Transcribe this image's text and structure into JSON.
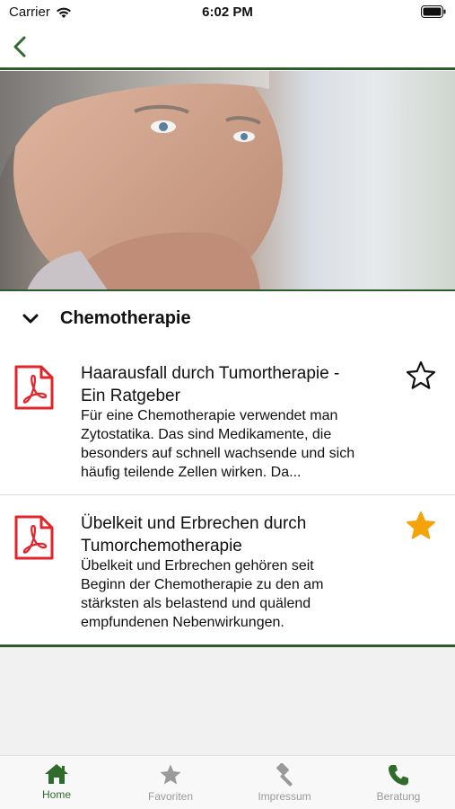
{
  "status_bar": {
    "carrier": "Carrier",
    "time": "6:02 PM"
  },
  "section": {
    "title": "Chemotherapie"
  },
  "documents": [
    {
      "title_line1": "Haarausfall durch Tumortherapie -",
      "title_line2": "Ein Ratgeber",
      "desc_lines": [
        "Für eine Chemotherapie verwendet man",
        "Zytostatika. Das sind Medikamente, die",
        "besonders auf schnell wachsende und sich",
        "häufig teilende Zellen wirken. Da..."
      ],
      "favorite": false
    },
    {
      "title_line1": "Übelkeit und Erbrechen durch",
      "title_line2": "Tumorchemotherapie",
      "desc_lines": [
        "Übelkeit und Erbrechen gehören seit",
        "Beginn der Chemotherapie zu den am",
        "stärksten als belastend und quälend",
        "empfundenen Nebenwirkungen."
      ],
      "favorite": true
    }
  ],
  "tab_bar": {
    "tabs": [
      {
        "label": "Home",
        "icon": "home-icon",
        "active": true
      },
      {
        "label": "Favoriten",
        "icon": "star-icon",
        "active": false
      },
      {
        "label": "Impressum",
        "icon": "gavel-icon",
        "active": false
      },
      {
        "label": "Beratung",
        "icon": "phone-icon",
        "active": false
      }
    ]
  },
  "colors": {
    "accent": "#2f6b2a",
    "divider": "#2f5a2c",
    "pdf_red": "#e1262b",
    "favorite_star": "#f4a30b"
  }
}
